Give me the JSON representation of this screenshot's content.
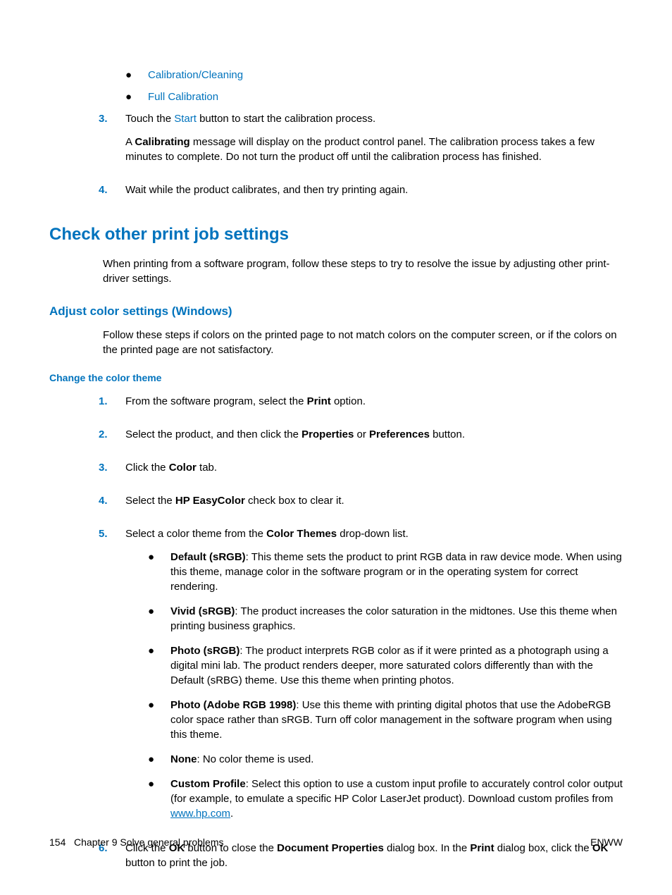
{
  "top_bullets": {
    "items": [
      {
        "text": "Calibration/Cleaning"
      },
      {
        "text": "Full Calibration"
      }
    ]
  },
  "ol_top": {
    "step3_num": "3.",
    "step3_a": "Touch the ",
    "step3_start": "Start",
    "step3_b": " button to start the calibration process.",
    "step3_para2_a": "A ",
    "step3_para2_bold": "Calibrating",
    "step3_para2_b": " message will display on the product control panel. The calibration process takes a few minutes to complete. Do not turn the product off until the calibration process has finished.",
    "step4_num": "4.",
    "step4_text": "Wait while the product calibrates, and then try printing again."
  },
  "h2": "Check other print job settings",
  "h2_para": "When printing from a software program, follow these steps to try to resolve the issue by adjusting other print-driver settings.",
  "h3": "Adjust color settings (Windows)",
  "h3_para": "Follow these steps if colors on the printed page to not match colors on the computer screen, or if the colors on the printed page are not satisfactory.",
  "h4": "Change the color theme",
  "theme_ol": {
    "s1_num": "1.",
    "s1_a": "From the software program, select the ",
    "s1_b": "Print",
    "s1_c": " option.",
    "s2_num": "2.",
    "s2_a": "Select the product, and then click the ",
    "s2_b": "Properties",
    "s2_c": " or ",
    "s2_d": "Preferences",
    "s2_e": " button.",
    "s3_num": "3.",
    "s3_a": "Click the ",
    "s3_b": "Color",
    "s3_c": " tab.",
    "s4_num": "4.",
    "s4_a": "Select the ",
    "s4_b": "HP EasyColor",
    "s4_c": " check box to clear it.",
    "s5_num": "5.",
    "s5_a": "Select a color theme from the ",
    "s5_b": "Color Themes",
    "s5_c": " drop-down list.",
    "s6_num": "6.",
    "s6_a": "Click the ",
    "s6_b": "OK",
    "s6_c": " button to close the ",
    "s6_d": "Document Properties",
    "s6_e": " dialog box. In the ",
    "s6_f": "Print",
    "s6_g": " dialog box, click the ",
    "s6_h": "OK",
    "s6_i": " button to print the job."
  },
  "themes": {
    "default_b": "Default (sRGB)",
    "default_t": ": This theme sets the product to print RGB data in raw device mode. When using this theme, manage color in the software program or in the operating system for correct rendering.",
    "vivid_b": "Vivid (sRGB)",
    "vivid_t": ": The product increases the color saturation in the midtones. Use this theme when printing business graphics.",
    "photo_b": "Photo (sRGB)",
    "photo_t": ": The product interprets RGB color as if it were printed as a photograph using a digital mini lab. The product renders deeper, more saturated colors differently than with the Default (sRBG) theme. Use this theme when printing photos.",
    "adobe_b": "Photo (Adobe RGB 1998)",
    "adobe_t": ": Use this theme with printing digital photos that use the AdobeRGB color space rather than sRGB. Turn off color management in the software program when using this theme.",
    "none_b": "None",
    "none_t": ": No color theme is used.",
    "custom_b": "Custom Profile",
    "custom_t1": ": Select this option to use a custom input profile to accurately control color output (for example, to emulate a specific HP Color LaserJet product). Download custom profiles from ",
    "custom_link": "www.hp.com",
    "custom_t2": "."
  },
  "footer": {
    "page_num": "154",
    "chapter": "Chapter 9   Solve general problems",
    "right": "ENWW"
  }
}
